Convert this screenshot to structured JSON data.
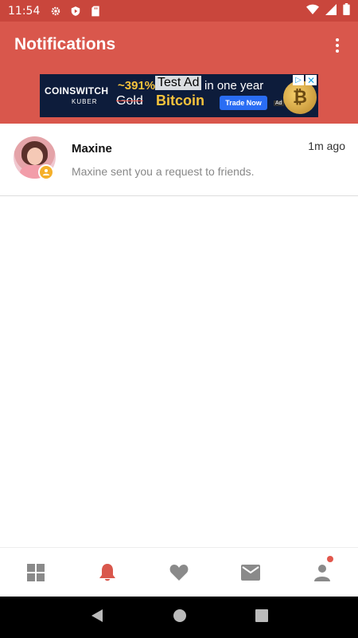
{
  "status_bar": {
    "time": "11:54",
    "icons": [
      "gear-icon",
      "play-shield-icon",
      "sd-card-icon"
    ],
    "right_icons": [
      "wifi-icon",
      "signal-icon",
      "battery-icon"
    ]
  },
  "app_bar": {
    "title": "Notifications",
    "menu_icon": "more-vert-icon",
    "background": "#d9574c"
  },
  "ad": {
    "brand": "COINSWITCH",
    "brand_sub": "KUBER",
    "percent": "~391%",
    "test_label": "Test Ad",
    "year_text": "in one year",
    "gold_text": "Gold",
    "bitcoin_text": "Bitcoin",
    "button": "Trade Now",
    "ad_tag": "Ad",
    "coin_symbol": "₿"
  },
  "notifications": [
    {
      "name": "Maxine",
      "time": "1m ago",
      "message": "Maxine sent you a request to friends."
    }
  ],
  "bottom_nav": {
    "tabs": [
      "grid-icon",
      "bell-icon",
      "heart-icon",
      "mail-icon",
      "person-icon"
    ],
    "active_index": 1,
    "active_color": "#d9574c",
    "inactive_color": "#8a8a8a"
  }
}
